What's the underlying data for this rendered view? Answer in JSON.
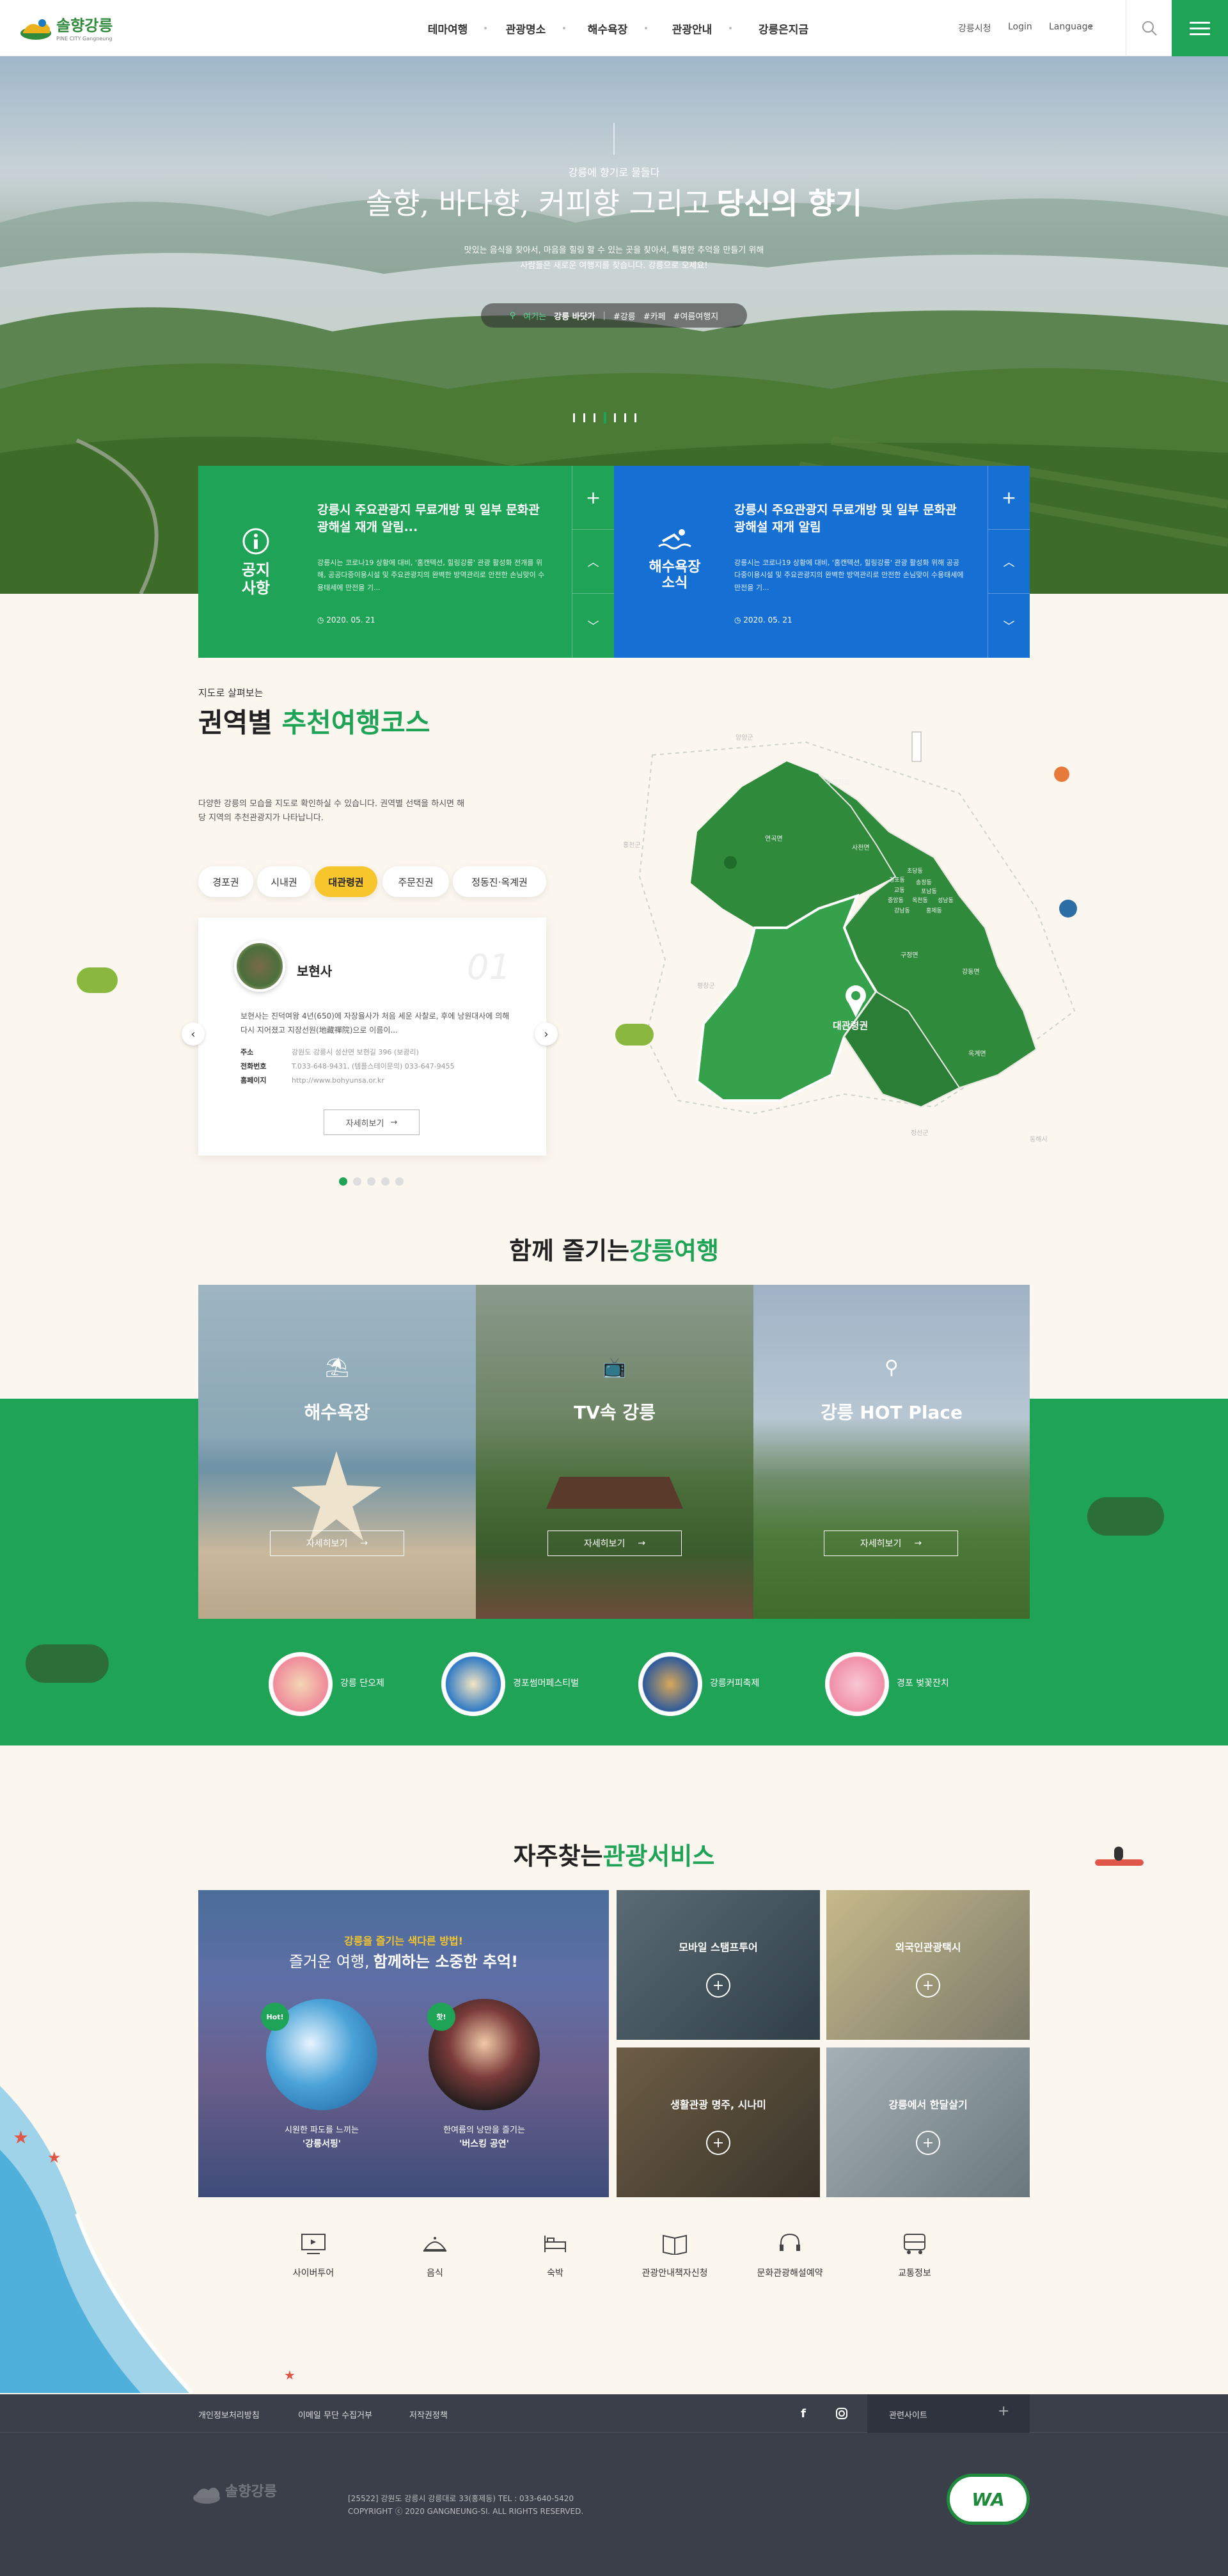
{
  "header": {
    "logo_text": "솔향강릉",
    "logo_sub": "PINE CITY Gangneung",
    "nav": [
      "테마여행",
      "관광명소",
      "해수욕장",
      "관광안내",
      "강릉은지금"
    ],
    "util": [
      "강릉시청",
      "Login",
      "Language"
    ]
  },
  "hero": {
    "small": "강릉에 향기로 물들다",
    "title_a": "솔향, 바다향, 커피향 그리고 ",
    "title_b": "당신의 향기",
    "desc1": "맛있는 음식을 찾아서, 마음을 힐링 할 수 있는 곳을 찾아서, 특별한 추억을 만들기 위해",
    "desc2": "사람들은 새로운 여행지를 찾습니다. 강릉으로 오세요!",
    "loc_label": "여기는",
    "loc_place": "강릉 바닷가",
    "tags": [
      "#강릉",
      "#카페",
      "#여름여행지"
    ]
  },
  "notice": [
    {
      "badge": "공지\n사항",
      "title": "강릉시 주요관광지 무료개방 및 일부 문화관광해설 재개 알림...",
      "body": "강릉시는 코로나19 상황에 대비, '홈캔텍션, 힐링강릉' 관광 활성화 전개를 위해, 공공다중이용시설 및 주요관광지의 완벽한 방역관리로 안전한 손님맞이 수용태세에 만전을 기...",
      "date": "2020. 05. 21",
      "bg": "#1fa356"
    },
    {
      "badge": "해수욕장\n소식",
      "title": "강릉시 주요관광지 무료개방 및 일부 문화관광해설 재개 알림",
      "body": "강릉시는 코로나19 상황에 대비, '홈캔텍션, 힐링강릉' 관광 활성화 위해 공공다중이용시설 및 주요관광지의 완벽한 방역관리로 안전한 손님맞이 수용태세에 만전을 기...",
      "date": "2020. 05. 21",
      "bg": "#1670d3"
    }
  ],
  "course": {
    "small": "지도로 살펴보는",
    "title_a": "권역별 ",
    "title_b": "추천여행코스",
    "desc": "다양한 강릉의 모습을 지도로 확인하실 수 있습니다. 권역별 선택을 하시면 해당 지역의 추천관광지가 나타납니다.",
    "tabs": [
      "경포권",
      "시내권",
      "대관령권",
      "주문진권",
      "정동진·옥계권"
    ],
    "active_tab": "대관령권",
    "card": {
      "name": "보현사",
      "num": "01",
      "desc": "보현사는 진덕여왕 4년(650)에 자장율사가 처음 세운 사찰로, 후에 낭원대사에 의해 다시 지어졌고 지장선원(地藏禪院)으로 이름이...",
      "rows": [
        [
          "주소",
          "강원도 강릉시 성산면 보현길 396 (보광리)"
        ],
        [
          "전화번호",
          "T.033-648-9431, (템플스테이문의) 033-647-9455"
        ],
        [
          "홈페이지",
          "http://www.bohyunsa.or.kr"
        ]
      ],
      "btn": "자세히보기"
    },
    "map_regions": [
      "주문진읍",
      "연곡면",
      "사천면",
      "초당동",
      "경포동",
      "송정동",
      "교동",
      "포남동",
      "중앙동",
      "옥천동",
      "성남동",
      "강남동",
      "홍제동",
      "구정면",
      "강동면",
      "옥계면",
      "대관령권"
    ],
    "map_out": [
      "양양군",
      "홍천군",
      "평창군",
      "정선군",
      "동해시"
    ]
  },
  "together": {
    "title_a": "함께 즐기는 ",
    "title_b": "강릉여행",
    "cards": [
      {
        "title": "해수욕장",
        "btn": "자세히보기"
      },
      {
        "title": "TV속 강릉",
        "btn": "자세히보기"
      },
      {
        "title": "강릉 HOT Place",
        "btn": "자세히보기"
      }
    ],
    "festivals": [
      "강릉 단오제",
      "경포썸머페스티벌",
      "강릉커피축제",
      "경포 벚꽃잔치"
    ]
  },
  "services": {
    "title_a": "자주찾는 ",
    "title_b": "관광서비스",
    "big": {
      "line1": "강릉을 즐기는 색다른 방법!",
      "line2a": "즐거운 여행, ",
      "line2b": "함께하는 소중한 추억!",
      "items": [
        [
          "시원한 파도를 느끼는",
          "'강릉서핑'"
        ],
        [
          "한여름의 낭만을 즐기는",
          "'버스킹 공연'"
        ]
      ],
      "badges": [
        "Hot!",
        "핫!"
      ]
    },
    "tiles": [
      "모바일 스탬프투어",
      "외국인관광택시",
      "생활관광 명주, 시나미",
      "강릉에서 한달살기"
    ],
    "icons": [
      "사이버투어",
      "음식",
      "숙박",
      "관광안내책자신청",
      "문화관광해설예약",
      "교통정보"
    ]
  },
  "footer": {
    "links": [
      "개인정보처리방침",
      "이메일 무단 수집거부",
      "저작권정책"
    ],
    "related": "관련사이트",
    "address": "[25522] 강원도 강릉시 강릉대로 33(홍제동)  TEL : 033-640-5420",
    "copy": "COPYRIGHT ⓒ 2020 GANGNEUNG-SI. ALL RIGHTS RESERVED.",
    "wa": "WA"
  },
  "colors": {
    "green": "#1fa356",
    "blue": "#1670d3",
    "dark": "#2e3440",
    "cream": "#fbf6ee"
  }
}
